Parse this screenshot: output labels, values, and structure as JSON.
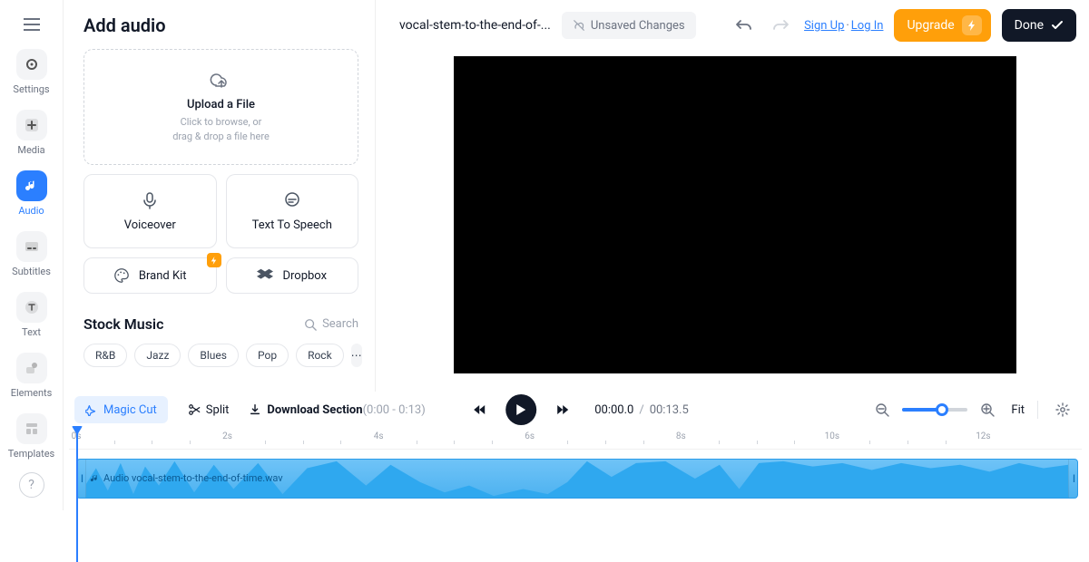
{
  "rail": {
    "items": [
      {
        "label": "Settings"
      },
      {
        "label": "Media"
      },
      {
        "label": "Audio"
      },
      {
        "label": "Subtitles"
      },
      {
        "label": "Text"
      },
      {
        "label": "Elements"
      },
      {
        "label": "Templates"
      }
    ]
  },
  "panel": {
    "title": "Add audio",
    "upload": {
      "title": "Upload a File",
      "sub1": "Click to browse, or",
      "sub2": "drag & drop a file here"
    },
    "voiceover": "Voiceover",
    "tts": "Text To Speech",
    "brandkit": "Brand Kit",
    "dropbox": "Dropbox",
    "stock": {
      "title": "Stock Music",
      "search": "Search",
      "tags": [
        "R&B",
        "Jazz",
        "Blues",
        "Pop",
        "Rock"
      ]
    }
  },
  "top": {
    "filename": "vocal-stem-to-the-end-of-...",
    "unsaved": "Unsaved Changes",
    "signup": "Sign Up",
    "login": "Log In",
    "upgrade": "Upgrade",
    "done": "Done"
  },
  "toolbar": {
    "magic": "Magic Cut",
    "split": "Split",
    "download": "Download Section",
    "download_range": "(0:00 - 0:13)",
    "time": {
      "current": "00:00.0",
      "duration": "00:13.5"
    },
    "fit": "Fit"
  },
  "timeline": {
    "ticks": [
      "0s",
      "2s",
      "4s",
      "6s",
      "8s",
      "10s",
      "12s"
    ],
    "clip_label": "Audio vocal-stem-to-the-end-of-time.wav"
  }
}
